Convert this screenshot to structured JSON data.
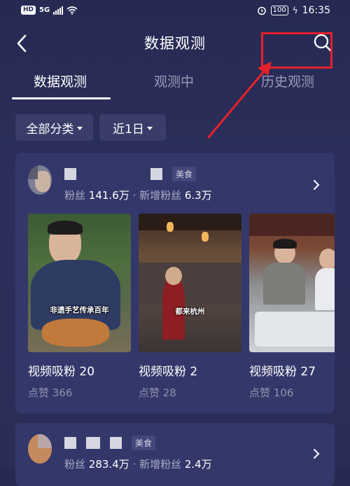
{
  "status": {
    "network": "5G",
    "hd": "HD",
    "battery": "100",
    "time": "16:35"
  },
  "header": {
    "title": "数据观测"
  },
  "tabs": [
    {
      "label": "数据观测",
      "active": true
    },
    {
      "label": "观测中",
      "active": false
    },
    {
      "label": "历史观测",
      "active": false
    }
  ],
  "filters": [
    {
      "label": "全部分类"
    },
    {
      "label": "近1日"
    }
  ],
  "cards": [
    {
      "category": "美食",
      "fans_label": "粉丝",
      "fans": "141.6万",
      "new_fans_label": "· 新增粉丝",
      "new_fans": "6.3万",
      "videos": [
        {
          "caption": "非遗手艺传承百年",
          "title": "视频吸粉 20",
          "likes": "点赞 366"
        },
        {
          "caption": "都来杭州",
          "title": "视频吸粉 2",
          "likes": "点赞 28"
        },
        {
          "caption": "",
          "title": "视频吸粉 27",
          "likes": "点赞 106"
        }
      ]
    },
    {
      "category": "美食",
      "fans_label": "粉丝",
      "fans": "283.4万",
      "new_fans_label": "· 新增粉丝",
      "new_fans": "2.4万"
    }
  ],
  "colors": {
    "background": "#2a2d58",
    "card": "#34376a",
    "annotation": "#e8202a"
  },
  "icons": [
    "back-icon",
    "search-icon",
    "caret-down-icon",
    "chevron-right-icon"
  ]
}
